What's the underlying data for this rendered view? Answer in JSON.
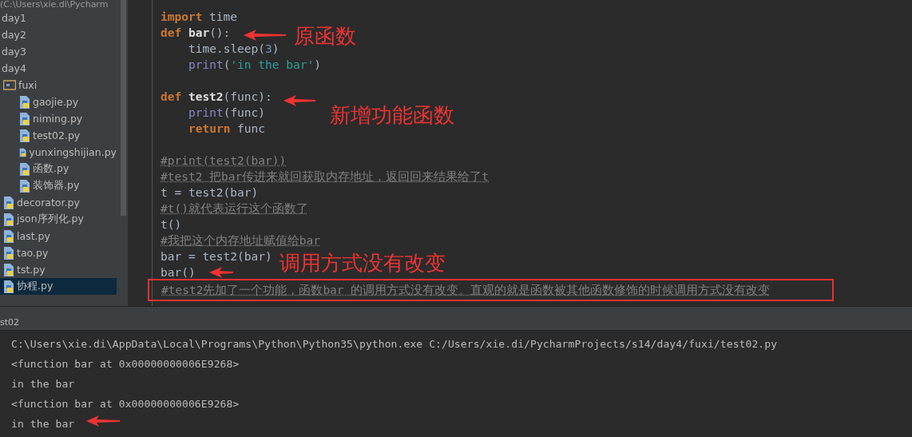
{
  "project_tree": {
    "root_path": "(C:\\Users\\xie.di\\Pycharm",
    "items": [
      {
        "label": "day1",
        "selected": false
      },
      {
        "label": "day2",
        "selected": false
      },
      {
        "label": "day3",
        "selected": false
      },
      {
        "label": "day4",
        "selected": false,
        "children": [
          {
            "label": "fuxi",
            "kind": "folder",
            "selected": false,
            "children": [
              {
                "label": "gaojie.py",
                "kind": "python",
                "selected": false
              },
              {
                "label": "niming.py",
                "kind": "python",
                "selected": false
              },
              {
                "label": "test02.py",
                "kind": "python",
                "selected": false
              },
              {
                "label": "yunxingshijian.py",
                "kind": "python",
                "selected": false
              },
              {
                "label": "函数.py",
                "kind": "python",
                "selected": false
              },
              {
                "label": "装饰器.py",
                "kind": "python",
                "selected": false
              }
            ]
          },
          {
            "label": "decorator.py",
            "kind": "python",
            "selected": false
          },
          {
            "label": "json序列化.py",
            "kind": "python",
            "selected": false
          },
          {
            "label": "last.py",
            "kind": "python",
            "selected": false
          },
          {
            "label": "tao.py",
            "kind": "python",
            "selected": false
          },
          {
            "label": "tst.py",
            "kind": "python",
            "selected": false
          },
          {
            "label": "协程.py",
            "kind": "python",
            "selected": true
          }
        ]
      }
    ]
  },
  "editor": {
    "lines": [
      {
        "tokens": [
          {
            "text": "import",
            "kind": "keyword"
          },
          {
            "text": " time",
            "kind": "plain"
          }
        ]
      },
      {
        "tokens": [
          {
            "text": "def",
            "kind": "keyword"
          },
          {
            "text": " bar",
            "kind": "funcname"
          },
          {
            "text": "():",
            "kind": "plain"
          }
        ],
        "children": [
          {
            "tokens": [
              {
                "text": "time.sleep(",
                "kind": "plain"
              },
              {
                "text": "3",
                "kind": "number"
              },
              {
                "text": ")",
                "kind": "plain"
              }
            ]
          },
          {
            "tokens": [
              {
                "text": "print",
                "kind": "builtin"
              },
              {
                "text": "(",
                "kind": "plain"
              },
              {
                "text": "'in the bar'",
                "kind": "string"
              },
              {
                "text": ")",
                "kind": "plain"
              }
            ]
          }
        ]
      },
      {
        "kind": "blank"
      },
      {
        "tokens": [
          {
            "text": "def",
            "kind": "keyword"
          },
          {
            "text": " test2",
            "kind": "funcname"
          },
          {
            "text": "(func):",
            "kind": "plain"
          }
        ],
        "children": [
          {
            "tokens": [
              {
                "text": "print",
                "kind": "builtin"
              },
              {
                "text": "(func)",
                "kind": "plain"
              }
            ]
          },
          {
            "tokens": [
              {
                "text": "return",
                "kind": "keyword"
              },
              {
                "text": " func",
                "kind": "plain"
              }
            ]
          }
        ]
      },
      {
        "kind": "blank"
      },
      {
        "tokens": [
          {
            "text": "#print(test2(bar))",
            "kind": "comment"
          }
        ]
      },
      {
        "tokens": [
          {
            "text": "#test2 把bar传进来就回获取内存地址，返回回来结果给了t",
            "kind": "comment"
          }
        ]
      },
      {
        "tokens": [
          {
            "text": "t = test2(bar)",
            "kind": "plain"
          }
        ]
      },
      {
        "tokens": [
          {
            "text": "#t()就代表运行这个函数了",
            "kind": "comment"
          }
        ]
      },
      {
        "tokens": [
          {
            "text": "t()",
            "kind": "plain"
          }
        ]
      },
      {
        "tokens": [
          {
            "text": "#我把这个内存地址赋值给bar",
            "kind": "comment"
          }
        ]
      },
      {
        "tokens": [
          {
            "text": "bar = test2(bar)",
            "kind": "plain"
          }
        ]
      },
      {
        "tokens": [
          {
            "text": "bar()",
            "kind": "plain"
          }
        ]
      },
      {
        "tokens": [
          {
            "text": "#test2先加了一个功能，函数bar 的调用方式没有改变。直观的就是函数被其他函数修饰的时候调用方式没有改变",
            "kind": "comment"
          }
        ],
        "boxed": true
      }
    ]
  },
  "annotations": [
    {
      "text": "原函数"
    },
    {
      "text": "新增功能函数"
    },
    {
      "text": "调用方式没有改变"
    }
  ],
  "run_panel": {
    "tab": "st02",
    "lines": [
      "C:\\Users\\xie.di\\AppData\\Local\\Programs\\Python\\Python35\\python.exe C:/Users/xie.di/PycharmProjects/s14/day4/fuxi/test02.py",
      "<function bar at 0x00000000006E9268>",
      "in the bar",
      "<function bar at 0x00000000006E9268>",
      "in the bar"
    ]
  }
}
